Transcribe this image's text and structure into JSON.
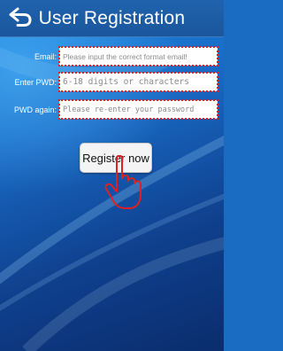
{
  "header": {
    "title": "User Registration",
    "back_icon": "back-arrow-icon"
  },
  "form": {
    "email": {
      "label": "Email:",
      "placeholder": "Please input the correct format email!",
      "value": ""
    },
    "password": {
      "label": "Enter PWD:",
      "placeholder": "6-18 digits or characters",
      "value": ""
    },
    "password_again": {
      "label": "PWD again:",
      "placeholder": "Please re-enter your password",
      "value": ""
    }
  },
  "actions": {
    "register_label": "Register now"
  },
  "annotations": {
    "highlight_color": "#e02020",
    "pointer_icon": "hand-pointer-icon"
  },
  "colors": {
    "header": "#1a569c",
    "background_light": "#1e8ae3",
    "background_dark": "#0a2d6d"
  }
}
